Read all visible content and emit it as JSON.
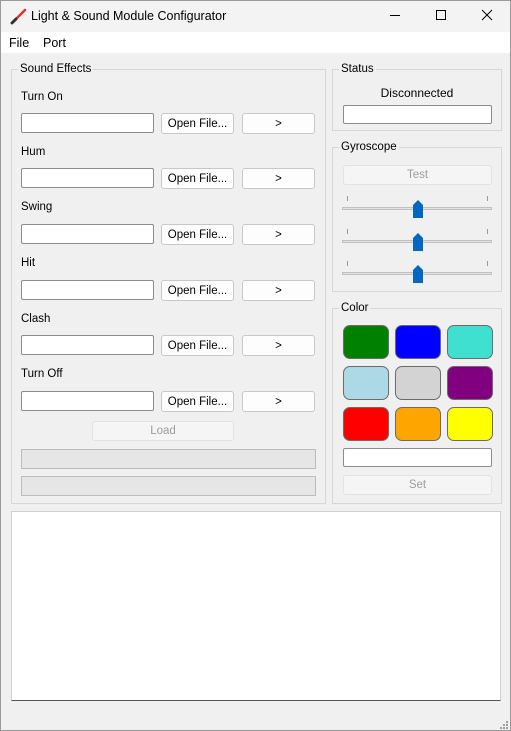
{
  "window": {
    "title": "Light & Sound Module Configurator",
    "controls": [
      "minimize",
      "maximize",
      "close"
    ]
  },
  "menu": {
    "items": [
      "File",
      "Port"
    ]
  },
  "sound_effects": {
    "title": "Sound Effects",
    "open_label": "Open File...",
    "play_label": ">",
    "rows": [
      {
        "label": "Turn On",
        "path": ""
      },
      {
        "label": "Hum",
        "path": ""
      },
      {
        "label": "Swing",
        "path": ""
      },
      {
        "label": "Hit",
        "path": ""
      },
      {
        "label": "Clash",
        "path": ""
      },
      {
        "label": "Turn Off",
        "path": ""
      }
    ],
    "load_label": "Load"
  },
  "status": {
    "title": "Status",
    "state": "Disconnected",
    "port_value": ""
  },
  "gyroscope": {
    "title": "Gyroscope",
    "test_label": "Test",
    "sliders": [
      {
        "name": "x",
        "value": 0.5
      },
      {
        "name": "y",
        "value": 0.5
      },
      {
        "name": "z",
        "value": 0.5
      }
    ]
  },
  "color": {
    "title": "Color",
    "swatches": [
      {
        "name": "green",
        "hex": "#008000"
      },
      {
        "name": "blue",
        "hex": "#0000ff"
      },
      {
        "name": "turquoise",
        "hex": "#40e0d0"
      },
      {
        "name": "lightblue",
        "hex": "#add8e6"
      },
      {
        "name": "lightgray",
        "hex": "#d3d3d3"
      },
      {
        "name": "purple",
        "hex": "#800080"
      },
      {
        "name": "red",
        "hex": "#ff0000"
      },
      {
        "name": "orange",
        "hex": "#ffa500"
      },
      {
        "name": "yellow",
        "hex": "#ffff00"
      }
    ],
    "value": "",
    "set_label": "Set"
  },
  "log": {
    "text": ""
  }
}
